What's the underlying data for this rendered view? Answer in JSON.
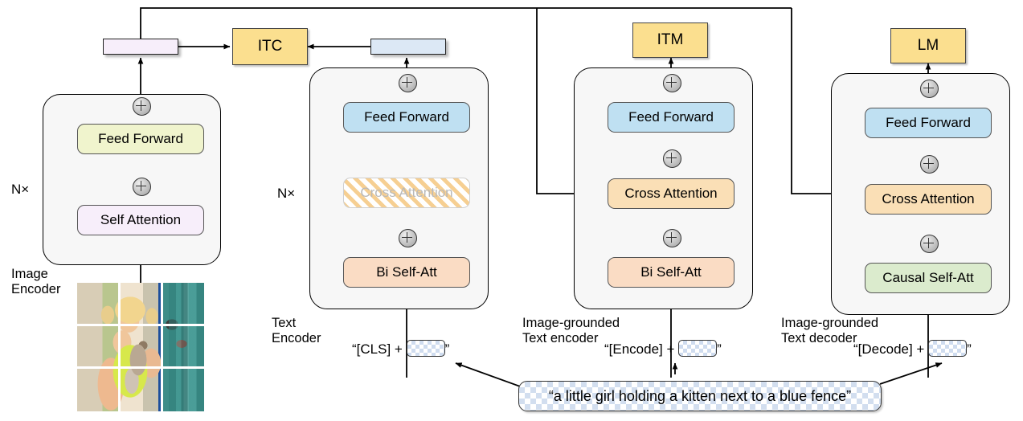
{
  "figure": {
    "type": "architecture-diagram",
    "name": "BLIP multimodal mixture of encoder-decoder"
  },
  "columns": [
    {
      "id": "image-encoder",
      "label": "Image\nEncoder",
      "repeat": "N×",
      "blocks": [
        {
          "name": "Feed Forward",
          "color": "#f0f4cd"
        },
        {
          "name": "Self Attention",
          "color": "#f7eefa"
        }
      ],
      "output_bar_color": "#f7eefa"
    },
    {
      "id": "text-encoder",
      "label": "Text\nEncoder",
      "repeat": "N×",
      "blocks": [
        {
          "name": "Feed Forward",
          "color": "#bfe0f2"
        },
        {
          "name": "Cross Attention",
          "color": "#fadfb6",
          "disabled": true
        },
        {
          "name": "Bi Self-Att",
          "color": "#fadcc4"
        }
      ],
      "output_bar_color": "#dce8f5",
      "input_prefix": "“[CLS] + ",
      "input_suffix": "”"
    },
    {
      "id": "image-grounded-text-encoder",
      "label": "Image-grounded\nText encoder",
      "blocks": [
        {
          "name": "Feed Forward",
          "color": "#bfe0f2"
        },
        {
          "name": "Cross Attention",
          "color": "#fadfb6"
        },
        {
          "name": "Bi Self-Att",
          "color": "#fadcc4"
        }
      ],
      "input_prefix": "“[Encode] + ",
      "input_suffix": "”"
    },
    {
      "id": "image-grounded-text-decoder",
      "label": "Image-grounded\nText decoder",
      "blocks": [
        {
          "name": "Feed Forward",
          "color": "#bfe0f2"
        },
        {
          "name": "Cross Attention",
          "color": "#fadfb6"
        },
        {
          "name": "Causal Self-Att",
          "color": "#dbebcd"
        }
      ],
      "input_prefix": "“[Decode] + ",
      "input_suffix": "”"
    }
  ],
  "objectives": [
    {
      "id": "itc",
      "label": "ITC",
      "color": "#fbdf8f"
    },
    {
      "id": "itm",
      "label": "ITM",
      "color": "#fbdf8f"
    },
    {
      "id": "lm",
      "label": "LM",
      "color": "#fbdf8f"
    }
  ],
  "caption": {
    "text": "“a little girl holding a kitten next to a blue fence”"
  },
  "labels": {
    "image_encoder_l1": "Image",
    "image_encoder_l2": "Encoder",
    "text_encoder_l1": "Text",
    "text_encoder_l2": "Encoder",
    "grounded_encoder_l1": "Image-grounded",
    "grounded_encoder_l2": "Text encoder",
    "grounded_decoder_l1": "Image-grounded",
    "grounded_decoder_l2": "Text decoder",
    "nx_image": "N×",
    "nx_text": "N×"
  },
  "colors": {
    "objective": "#fbdf8f",
    "feed_forward_img": "#f0f4cd",
    "feed_forward_txt": "#bfe0f2",
    "self_attention": "#f7eefa",
    "cross_attention": "#fadfb6",
    "bi_self_att": "#fadcc4",
    "causal_self_att": "#dbebcd",
    "image_feature_bar": "#f7eefa",
    "text_feature_bar": "#dce8f5",
    "stroke": "#000000"
  },
  "image_patch_grid": {
    "rows": 3,
    "cols": 3
  }
}
